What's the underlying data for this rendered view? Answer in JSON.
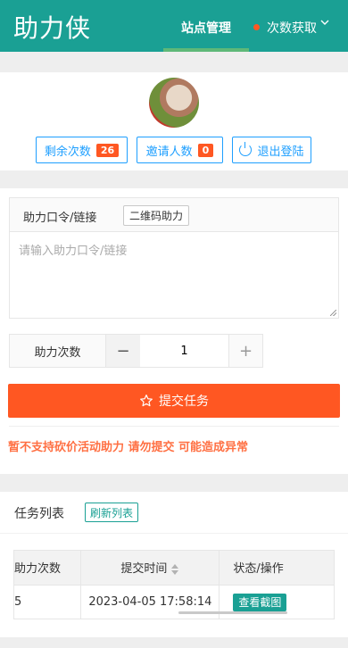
{
  "header": {
    "brand": "助力侠",
    "nav": [
      {
        "label": "站点管理",
        "active": true
      },
      {
        "label": "次数获取",
        "active": false
      }
    ],
    "colors": {
      "bar": "#1aa094",
      "active_indicator": "#5fb878",
      "dot": "#ff5722"
    }
  },
  "user": {
    "avatar": "avatar-photo",
    "remaining": {
      "label": "剩余次数",
      "value": "26"
    },
    "invited": {
      "label": "邀请人数",
      "value": "0"
    },
    "logout": {
      "label": "退出登陆",
      "icon": "power-icon"
    }
  },
  "form": {
    "code_label": "助力口令/链接",
    "qr_button": "二维码助力",
    "code_placeholder": "请输入助力口令/链接",
    "code_value": "",
    "count_label": "助力次数",
    "count_value": "1",
    "minus": "−",
    "plus": "+",
    "submit": "提交任务",
    "submit_icon": "star-icon",
    "warning": "暂不支持砍价活动助力 请勿提交 可能造成异常",
    "colors": {
      "submit": "#ff5722",
      "warning": "#ff5722"
    }
  },
  "tasks": {
    "title": "任务列表",
    "refresh": "刷新列表",
    "columns": [
      "助力次数",
      "提交时间",
      "状态/操作"
    ],
    "rows": [
      {
        "count": "5",
        "time": "2023-04-05 17:58:14",
        "action": "查看截图"
      }
    ]
  }
}
